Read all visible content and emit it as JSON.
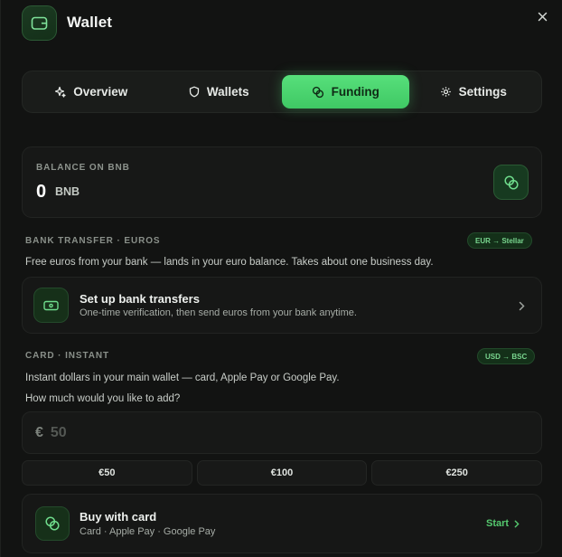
{
  "window": {
    "title": "Wallet"
  },
  "tabs": [
    {
      "label": "Overview",
      "icon": "sparkle-icon",
      "active": false
    },
    {
      "label": "Wallets",
      "icon": "shield-icon",
      "active": false
    },
    {
      "label": "Funding",
      "icon": "coins-icon",
      "active": true
    },
    {
      "label": "Settings",
      "icon": "gear-icon",
      "active": false
    }
  ],
  "balance": {
    "label": "BALANCE ON BNB",
    "value": "0",
    "unit": "BNB"
  },
  "bank": {
    "heading": "BANK TRANSFER · EUROS",
    "badge": "EUR → Stellar",
    "description": "Free euros from your bank — lands in your euro balance. Takes about one business day.",
    "title": "Set up bank transfers",
    "subtitle": "One-time verification, then send euros from your bank anytime."
  },
  "card": {
    "heading": "CARD · INSTANT",
    "badge": "USD → BSC",
    "description": "Instant dollars in your main wallet — card, Apple Pay or Google Pay.",
    "prompt": "How much would you like to add?",
    "currency_symbol": "€",
    "amount_placeholder": "50",
    "presets": [
      "€50",
      "€100",
      "€250"
    ],
    "buy_title": "Buy with card",
    "buy_subtitle": "Card · Apple Pay · Google Pay",
    "start_label": "Start"
  },
  "colors": {
    "accent": "#4fd672",
    "background": "#121312"
  }
}
